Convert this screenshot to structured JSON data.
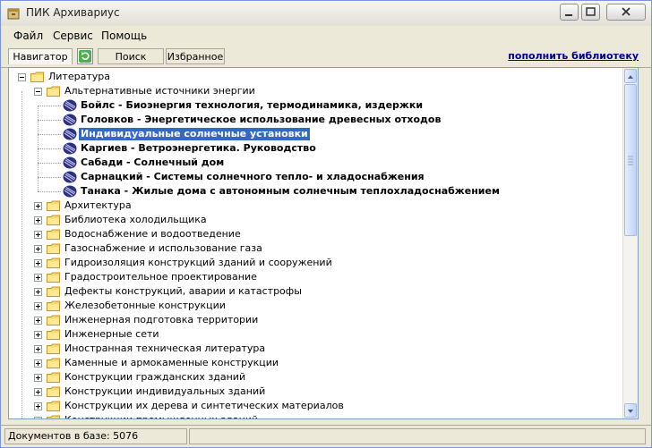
{
  "window": {
    "title": "ПИК Архивариус"
  },
  "menu": [
    {
      "label": "Файл"
    },
    {
      "label": "Сервис"
    },
    {
      "label": "Помощь"
    }
  ],
  "toolbar": {
    "tabs": [
      {
        "label": "Навигатор"
      },
      {
        "label": "Поиск"
      },
      {
        "label": "Избранное"
      }
    ],
    "refresh_icon": "refresh-icon",
    "library_link": "пополнить библиотеку"
  },
  "tree": {
    "root": "Литература",
    "expanded_folder": "Альтернативные источники энергии",
    "documents": [
      "Бойлс - Биоэнергия технология, термодинамика, издержки",
      "Головков - Энергетическое использование древесных отходов",
      "Индивидуальные солнечные установки",
      "Каргиев - Ветроэнергетика. Руководство",
      "Сабади - Солнечный дом",
      "Сарнацкий - Системы солнечного тепло- и хладоснабжения",
      "Танака - Жилые дома с автономным солнечным теплохладоснабжением"
    ],
    "selected_document": "Индивидуальные солнечные установки",
    "folders": [
      "Архитектура",
      "Библиотека холодильщика",
      "Водоснабжение и водоотведение",
      "Газоснабжение и использование газа",
      "Гидроизоляция конструкций зданий и сооружений",
      "Градостроительное проектирование",
      "Дефекты конструкций, аварии и катастрофы",
      "Железобетонные конструкции",
      "Инженерная подготовка территории",
      "Инженерные сети",
      "Иностранная техническая литература",
      "Каменные и армокаменные конструкции",
      "Конструкции гражданских зданий",
      "Конструкции индивидуальных зданий",
      "Конструкции их дерева и синтетических материалов",
      "Конструкции промышленных зданий"
    ]
  },
  "status": {
    "documents_count": "Документов в базе: 5076"
  },
  "colors": {
    "selection": "#316ac5",
    "link": "#00008b",
    "window_bg": "#ece9d8"
  }
}
